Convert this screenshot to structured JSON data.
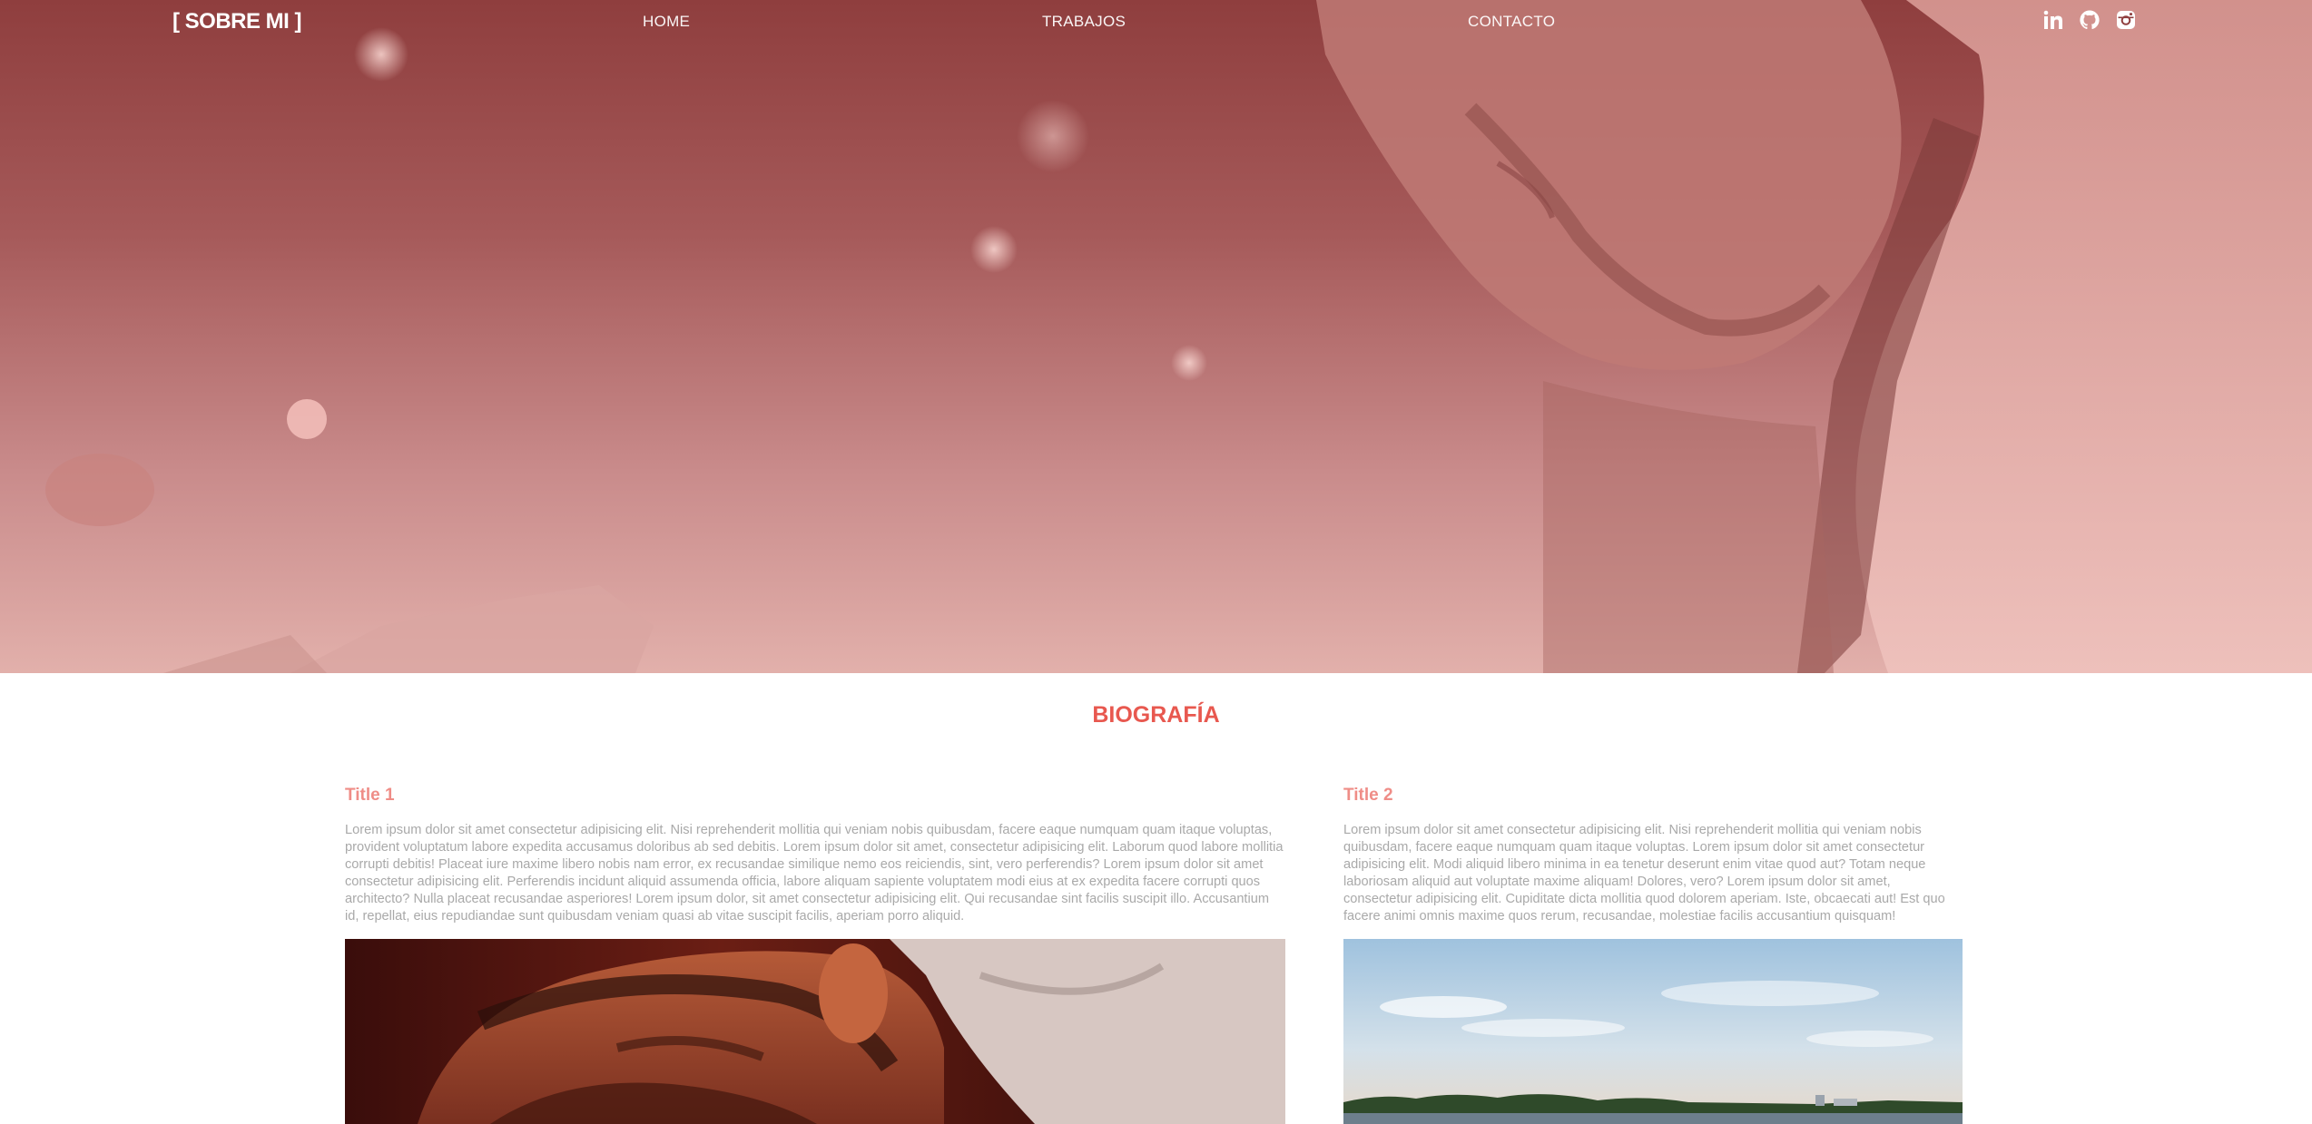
{
  "header": {
    "brand": "[ SOBRE MI ]",
    "nav": [
      {
        "label": "HOME"
      },
      {
        "label": "TRABAJOS"
      },
      {
        "label": "CONTACTO"
      }
    ],
    "social_icons": [
      "linkedin-icon",
      "github-icon",
      "instagram-icon"
    ]
  },
  "main": {
    "section_title": "BIOGRAFÍA",
    "columns": [
      {
        "title": "Title 1",
        "text": "Lorem ipsum dolor sit amet consectetur adipisicing elit. Nisi reprehenderit mollitia qui veniam nobis quibusdam, facere eaque numquam quam itaque voluptas, provident voluptatum labore expedita accusamus doloribus ab sed debitis. Lorem ipsum dolor sit amet, consectetur adipisicing elit. Laborum quod labore mollitia corrupti debitis! Placeat iure maxime libero nobis nam error, ex recusandae similique nemo eos reiciendis, sint, vero perferendis? Lorem ipsum dolor sit amet consectetur adipisicing elit. Perferendis incidunt aliquid assumenda officia, labore aliquam sapiente voluptatem modi eius at ex expedita facere corrupti quos architecto? Nulla placeat recusandae asperiores! Lorem ipsum dolor, sit amet consectetur adipisicing elit. Qui recusandae sint facilis suscipit illo. Accusantium id, repellat, eius repudiandae sunt quibusdam veniam quasi ab vitae suscipit facilis, aperiam porro aliquid."
      },
      {
        "title": "Title 2",
        "text": "Lorem ipsum dolor sit amet consectetur adipisicing elit. Nisi reprehenderit mollitia qui veniam nobis quibusdam, facere eaque numquam quam itaque voluptas. Lorem ipsum dolor sit amet consectetur adipisicing elit. Modi aliquid libero minima in ea tenetur deserunt enim vitae quod aut? Totam neque laboriosam aliquid aut voluptate maxime aliquam! Dolores, vero? Lorem ipsum dolor sit amet, consectetur adipisicing elit. Cupiditate dicta mollitia quod dolorem aperiam. Iste, obcaecati aut! Est quo facere animi omnis maxime quos rerum, recusandae, molestiae facilis accusantium quisquam!"
      }
    ]
  },
  "colors": {
    "accent": "#e8584f",
    "subtitle": "#ef8d87",
    "body_text": "#a9a9a9",
    "hero_tint": "#a65a5a"
  }
}
